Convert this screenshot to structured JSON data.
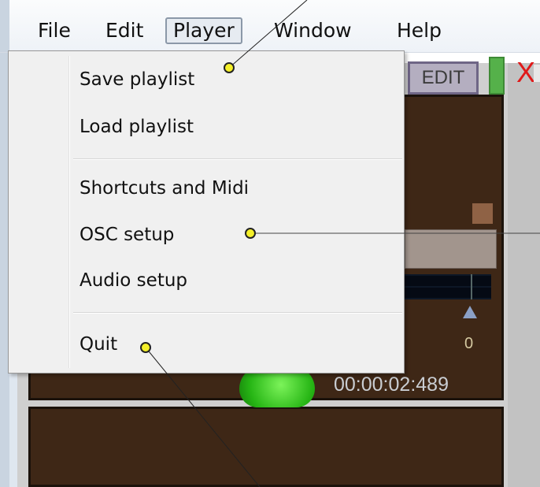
{
  "menubar": {
    "items": [
      {
        "label": "File"
      },
      {
        "label": "Edit"
      },
      {
        "label": "Player"
      },
      {
        "label": "Window"
      },
      {
        "label": "Help"
      }
    ],
    "active": "Player"
  },
  "player_menu": {
    "items": [
      {
        "label": "Save playlist"
      },
      {
        "label": "Load playlist"
      },
      {
        "label": "Shortcuts and Midi"
      },
      {
        "label": "OSC setup"
      },
      {
        "label": "Audio setup"
      },
      {
        "label": "Quit"
      }
    ]
  },
  "toolbar": {
    "edit_label": "EDIT",
    "close_label": "X"
  },
  "player": {
    "volume_value": "0",
    "time": "00:00:02:489",
    "play_button_icon": "play-icon"
  },
  "colors": {
    "panel": "#3e2716",
    "accent_green": "#55b14a",
    "close_red": "#e01818",
    "callout_dot": "#f5f02a"
  }
}
